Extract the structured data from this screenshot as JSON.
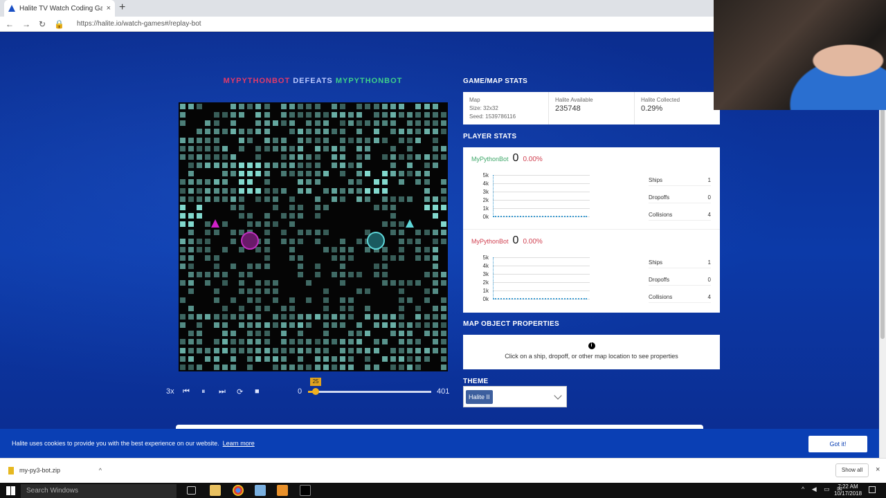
{
  "browser": {
    "tab_title": "Halite TV Watch Coding Game V",
    "tab_close": "×",
    "new_tab": "+",
    "url": "https://halite.io/watch-games#/replay-bot"
  },
  "game": {
    "winner": "MYPYTHONBOT",
    "defeats": "DEFEATS",
    "loser": "MYPYTHONBOT"
  },
  "playback": {
    "speed": "3x",
    "start": "0",
    "end": "401",
    "current_turn": "25",
    "progress_fraction": 0.062
  },
  "game_map_stats": {
    "header": "GAME/MAP STATS",
    "map_label": "Map",
    "size": "Size: 32x32",
    "seed": "Seed: 1539786116",
    "halite_available_label": "Halite Available",
    "halite_available": "235748",
    "halite_collected_label": "Halite Collected",
    "halite_collected": "0.29%"
  },
  "player_stats": {
    "header": "PLAYER STATS",
    "players": [
      {
        "name": "MyPythonBot",
        "score": "0",
        "pct": "0.00%",
        "ships": "1",
        "dropoffs": "0",
        "collisions": "4",
        "color": "#3fa86a"
      },
      {
        "name": "MyPythonBot",
        "score": "0",
        "pct": "0.00%",
        "ships": "1",
        "dropoffs": "0",
        "collisions": "4",
        "color": "#d04050"
      }
    ],
    "labels": {
      "ships": "Ships",
      "dropoffs": "Dropoffs",
      "collisions": "Collisions"
    },
    "y_ticks": [
      "5k",
      "4k",
      "3k",
      "2k",
      "1k",
      "0k"
    ]
  },
  "map_object": {
    "header": "MAP OBJECT PROPERTIES",
    "info": "i",
    "hint": "Click on a ship, dropoff, or other map location to see properties"
  },
  "theme": {
    "header": "THEME",
    "selected": "Halite II"
  },
  "cookie": {
    "message": "Halite uses cookies to provide you with the best experience on our website.",
    "learn_more": "Learn more",
    "got_it": "Got it!"
  },
  "downloads": {
    "file": "my-py3-bot.zip",
    "show_all": "Show all",
    "close": "×"
  },
  "taskbar": {
    "search": "Search Windows",
    "time": "7:22 AM",
    "date": "10/17/2018"
  }
}
